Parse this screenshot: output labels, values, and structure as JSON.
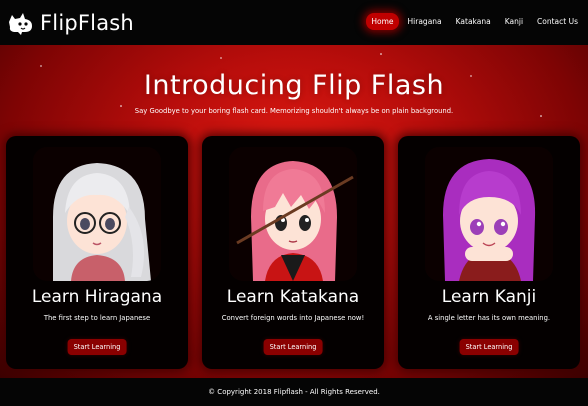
{
  "brand": {
    "name": "FlipFlash",
    "logo_icon": "dog-logo-icon"
  },
  "nav": {
    "items": [
      {
        "label": "Home",
        "active": true
      },
      {
        "label": "Hiragana",
        "active": false
      },
      {
        "label": "Katakana",
        "active": false
      },
      {
        "label": "Kanji",
        "active": false
      },
      {
        "label": "Contact Us",
        "active": false
      }
    ]
  },
  "hero": {
    "title": "Introducing Flip Flash",
    "subtitle": "Say Goodbye to your boring flash card. Memorizing shouldn't always be on plain background."
  },
  "cards": [
    {
      "title": "Learn Hiragana",
      "description": "The first step to learn Japanese",
      "button": "Start Learning",
      "portrait": "silver-haired-girl-with-glasses-portrait"
    },
    {
      "title": "Learn Katakana",
      "description": "Convert foreign words into Japanese now!",
      "button": "Start Learning",
      "portrait": "pink-haired-warrior-girl-portrait"
    },
    {
      "title": "Learn Kanji",
      "description": "A single letter has its own meaning.",
      "button": "Start Learning",
      "portrait": "purple-haired-girl-portrait"
    }
  ],
  "footer": {
    "text": "© Copyright 2018 Flipflash - All Rights Reserved."
  },
  "colors": {
    "accent": "#c00000",
    "hero_center": "#e11a12",
    "hero_edge": "#3c0000",
    "nav_bg": "#050505"
  }
}
